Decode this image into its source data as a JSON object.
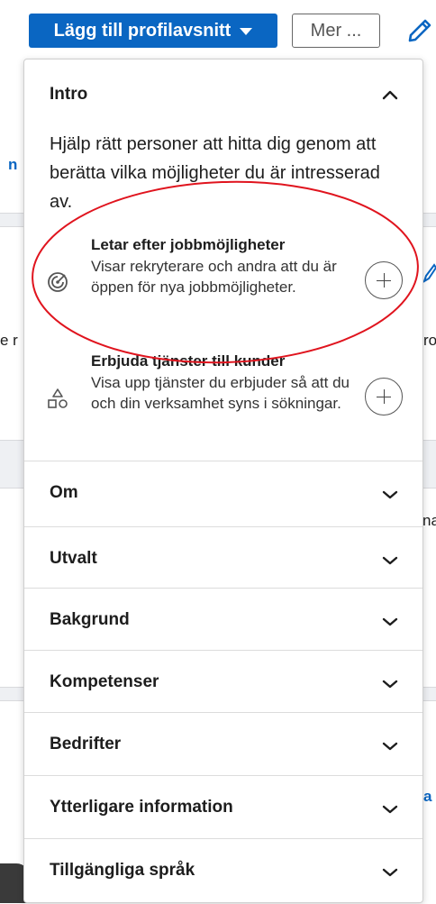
{
  "toolbar": {
    "add_section_label": "Lägg till profilavsnitt",
    "more_label": "Mer ...",
    "accent": "#0a66c2"
  },
  "background": {
    "frag_1": "n",
    "frag_2": "e r",
    "frag_3": "ro",
    "frag_4": "na",
    "frag_5": "a"
  },
  "intro": {
    "label": "Intro",
    "description": "Hjälp rätt personer att hitta dig genom att berätta vilka möjligheter du är intresserad av.",
    "options": [
      {
        "icon": "radar-target-icon",
        "title": "Letar efter jobbmöjligheter",
        "description": "Visar rekryterare och andra att du är öppen för nya jobbmöjligheter."
      },
      {
        "icon": "shapes-icon",
        "title": "Erbjuda tjänster till kunder",
        "description": "Visa upp tjänster du erbjuder så att du och din verksamhet syns i sökningar."
      }
    ]
  },
  "sections": [
    {
      "label": "Om"
    },
    {
      "label": "Utvalt"
    },
    {
      "label": "Bakgrund"
    },
    {
      "label": "Kompetenser"
    },
    {
      "label": "Bedrifter"
    },
    {
      "label": "Ytterligare information"
    },
    {
      "label": "Tillgängliga språk"
    }
  ],
  "annotation_color": "#e0141e"
}
